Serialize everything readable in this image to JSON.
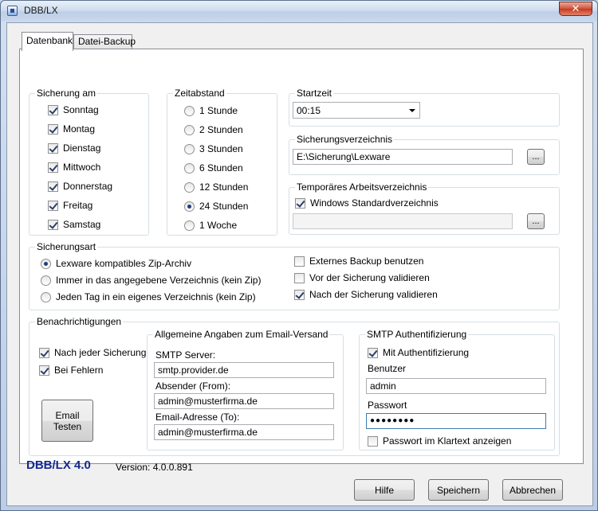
{
  "window": {
    "title": "DBB/LX",
    "close_glyph": "✕"
  },
  "tabs": [
    {
      "label": "Datenbank"
    },
    {
      "label": "Datei-Backup"
    }
  ],
  "sicherung_am": {
    "title": "Sicherung am",
    "days": [
      {
        "label": "Sonntag",
        "checked": true
      },
      {
        "label": "Montag",
        "checked": true
      },
      {
        "label": "Dienstag",
        "checked": true
      },
      {
        "label": "Mittwoch",
        "checked": true
      },
      {
        "label": "Donnerstag",
        "checked": true
      },
      {
        "label": "Freitag",
        "checked": true
      },
      {
        "label": "Samstag",
        "checked": true
      }
    ]
  },
  "zeitabstand": {
    "title": "Zeitabstand",
    "options": [
      {
        "label": "1 Stunde",
        "selected": false
      },
      {
        "label": "2 Stunden",
        "selected": false
      },
      {
        "label": "3 Stunden",
        "selected": false
      },
      {
        "label": "6 Stunden",
        "selected": false
      },
      {
        "label": "12 Stunden",
        "selected": false
      },
      {
        "label": "24 Stunden",
        "selected": true
      },
      {
        "label": "1 Woche",
        "selected": false
      }
    ]
  },
  "startzeit": {
    "title": "Startzeit",
    "value": "00:15"
  },
  "sicherungsverzeichnis": {
    "title": "Sicherungsverzeichnis",
    "path": "E:\\Sicherung\\Lexware",
    "browse_label": "..."
  },
  "temp_dir": {
    "title": "Temporäres Arbeitsverzeichnis",
    "standard_label": "Windows Standardverzeichnis",
    "standard_checked": true,
    "path": "",
    "browse_label": "..."
  },
  "sicherungsart": {
    "title": "Sicherungsart",
    "modes": [
      {
        "label": "Lexware kompatibles Zip-Archiv",
        "selected": true
      },
      {
        "label": "Immer in das angegebene Verzeichnis (kein Zip)",
        "selected": false
      },
      {
        "label": "Jeden Tag in ein eigenes Verzeichnis (kein Zip)",
        "selected": false
      }
    ],
    "options": [
      {
        "label": "Externes Backup benutzen",
        "checked": false
      },
      {
        "label": "Vor der Sicherung validieren",
        "checked": false
      },
      {
        "label": "Nach der Sicherung validieren",
        "checked": true
      }
    ]
  },
  "benachrichtigungen": {
    "title": "Benachrichtigungen",
    "options": [
      {
        "label": "Nach jeder Sicherung",
        "checked": true
      },
      {
        "label": "Bei Fehlern",
        "checked": true
      }
    ],
    "test_button_line1": "Email",
    "test_button_line2": "Testen"
  },
  "email": {
    "title": "Allgemeine Angaben zum Email-Versand",
    "smtp_label": "SMTP Server:",
    "smtp_value": "smtp.provider.de",
    "from_label": "Absender (From):",
    "from_value": "admin@musterfirma.de",
    "to_label": "Email-Adresse (To):",
    "to_value": "admin@musterfirma.de"
  },
  "smtp_auth": {
    "title": "SMTP Authentifizierung",
    "auth_label": "Mit Authentifizierung",
    "auth_checked": true,
    "user_label": "Benutzer",
    "user_value": "admin",
    "pass_label": "Passwort",
    "pass_value": "●●●●●●●●",
    "show_label": "Passwort im Klartext anzeigen",
    "show_checked": false
  },
  "footer": {
    "brand": "DBB/LX 4.0",
    "version": "Version: 4.0.0.891",
    "help_label": "Hilfe",
    "save_label": "Speichern",
    "cancel_label": "Abbrechen"
  }
}
